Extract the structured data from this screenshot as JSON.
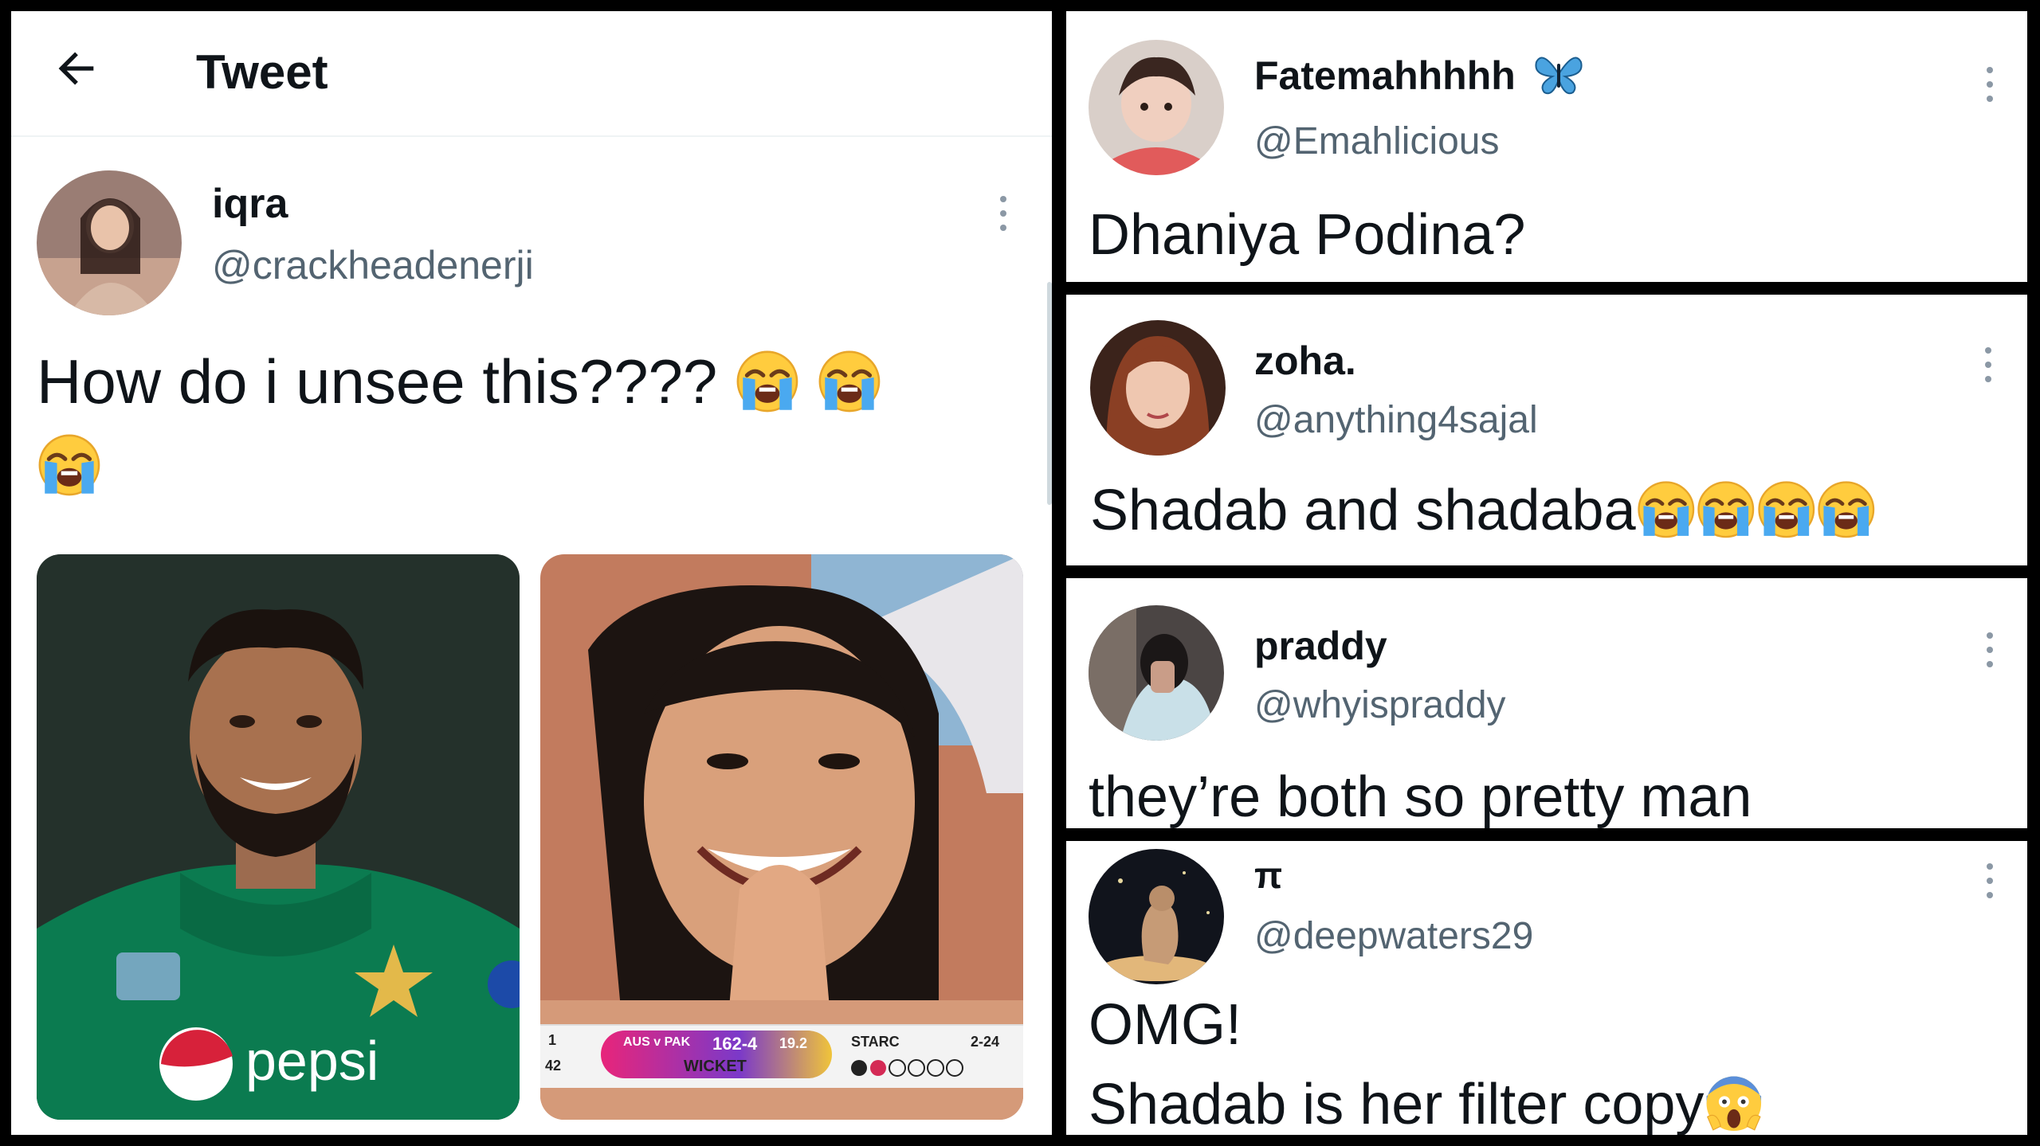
{
  "header": {
    "title": "Tweet"
  },
  "main_tweet": {
    "name": "iqra",
    "handle": "@crackheadenerji",
    "text": "How do i unsee this????",
    "emoji": "loudly-crying-face",
    "emoji_count": 3
  },
  "scoreboard": {
    "teams": "AUS v PAK",
    "score": "162-4",
    "overs": "19.2",
    "event": "WICKET",
    "bowler": "STARC",
    "bowler_figures": "2-24",
    "left_a": "1",
    "left_b": "42",
    "sponsor": "pepsi"
  },
  "replies": [
    {
      "name": "Fatemahhhhh",
      "badge": "butterfly-emoji",
      "handle": "@Emahlicious",
      "text": "Dhaniya Podina?"
    },
    {
      "name": "zoha.",
      "handle": "@anything4sajal",
      "text": "Shadab and shadaba",
      "emoji": "loudly-crying-face",
      "emoji_count": 4
    },
    {
      "name": "praddy",
      "handle": "@whyispraddy",
      "text": "they’re both so pretty man"
    },
    {
      "name": "π",
      "handle": "@deepwaters29",
      "text_line1": "OMG!",
      "text_line2": "Shadab is her filter copy",
      "emoji": "face-screaming-in-fear"
    }
  ],
  "colors": {
    "text": "#0f1419",
    "secondary": "#536471",
    "jersey": "#0b7b50",
    "border": "#000000"
  }
}
